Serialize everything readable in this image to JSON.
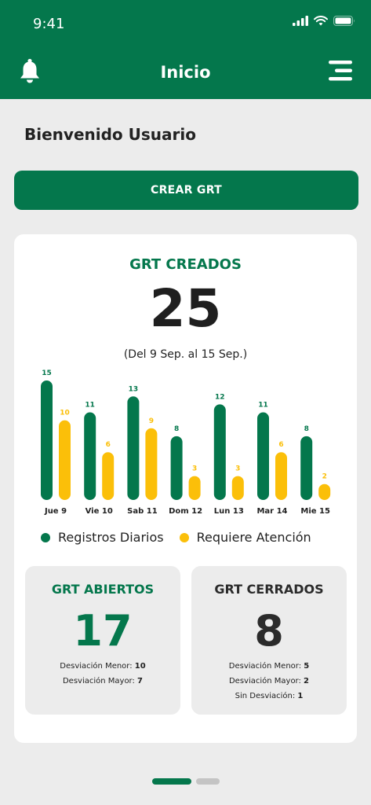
{
  "status_bar": {
    "time": "9:41"
  },
  "header": {
    "title": "Inicio",
    "left_icon": "bell-icon",
    "right_icon": "menu-icon"
  },
  "welcome": "Bienvenido Usuario",
  "create_button": "CREAR GRT",
  "summary": {
    "title": "GRT CREADOS",
    "total": "25",
    "range": "(Del 9 Sep. al 15 Sep.)"
  },
  "chart_data": {
    "type": "bar",
    "categories": [
      "Jue 9",
      "Vie 10",
      "Sab 11",
      "Dom 12",
      "Lun 13",
      "Mar 14",
      "Mie 15"
    ],
    "series": [
      {
        "name": "Registros Diarios",
        "values": [
          15,
          11,
          13,
          8,
          12,
          11,
          8
        ],
        "color": "#04774c"
      },
      {
        "name": "Requiere Atención",
        "values": [
          10,
          6,
          9,
          3,
          3,
          6,
          2
        ],
        "color": "#fbbf09"
      }
    ],
    "ylim": [
      0,
      15
    ],
    "grid": false,
    "legend": "bottom"
  },
  "open": {
    "title": "GRT ABIERTOS",
    "value": "17",
    "lines": [
      {
        "label": "Desviación Menor: ",
        "value": "10"
      },
      {
        "label": "Desviación Mayor: ",
        "value": "7"
      }
    ]
  },
  "closed": {
    "title": "GRT CERRADOS",
    "value": "8",
    "lines": [
      {
        "label": "Desviación Menor: ",
        "value": "5"
      },
      {
        "label": "Desviación Mayor: ",
        "value": "2"
      },
      {
        "label": "Sin Desviación: ",
        "value": "1"
      }
    ]
  },
  "colors": {
    "primary": "#04774c",
    "accent": "#fbbf09",
    "background": "#ececec"
  }
}
